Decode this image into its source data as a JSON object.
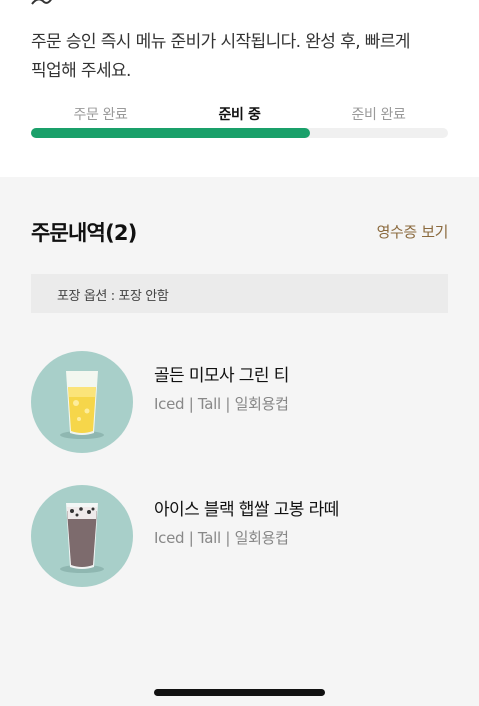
{
  "notice": {
    "line1": "주문 승인 즉시 메뉴 준비가 시작됩니다. 완성 후, 빠르게",
    "line2": "픽업해 주세요."
  },
  "progress": {
    "steps": [
      {
        "label": "주문 완료",
        "active": false
      },
      {
        "label": "준비 중",
        "active": true
      },
      {
        "label": "준비 완료",
        "active": false
      }
    ],
    "fill_fraction": 0.67,
    "accent_color": "#1aa06a"
  },
  "orders": {
    "title": "주문내역(2)",
    "receipt_link": "영수증 보기",
    "packaging": "포장 옵션 : 포장 안함",
    "items": [
      {
        "name": "골든 미모사 그린 티",
        "options": "Iced | Tall | 일회용컵",
        "image": "iced-yellow-drink"
      },
      {
        "name": "아이스 블랙 햅쌀 고봉 라떼",
        "options": "Iced | Tall | 일회용컵",
        "image": "iced-black-rice-latte"
      }
    ]
  },
  "colors": {
    "link": "#8b6a3e",
    "thumb_bg": "#a8cfc9"
  }
}
